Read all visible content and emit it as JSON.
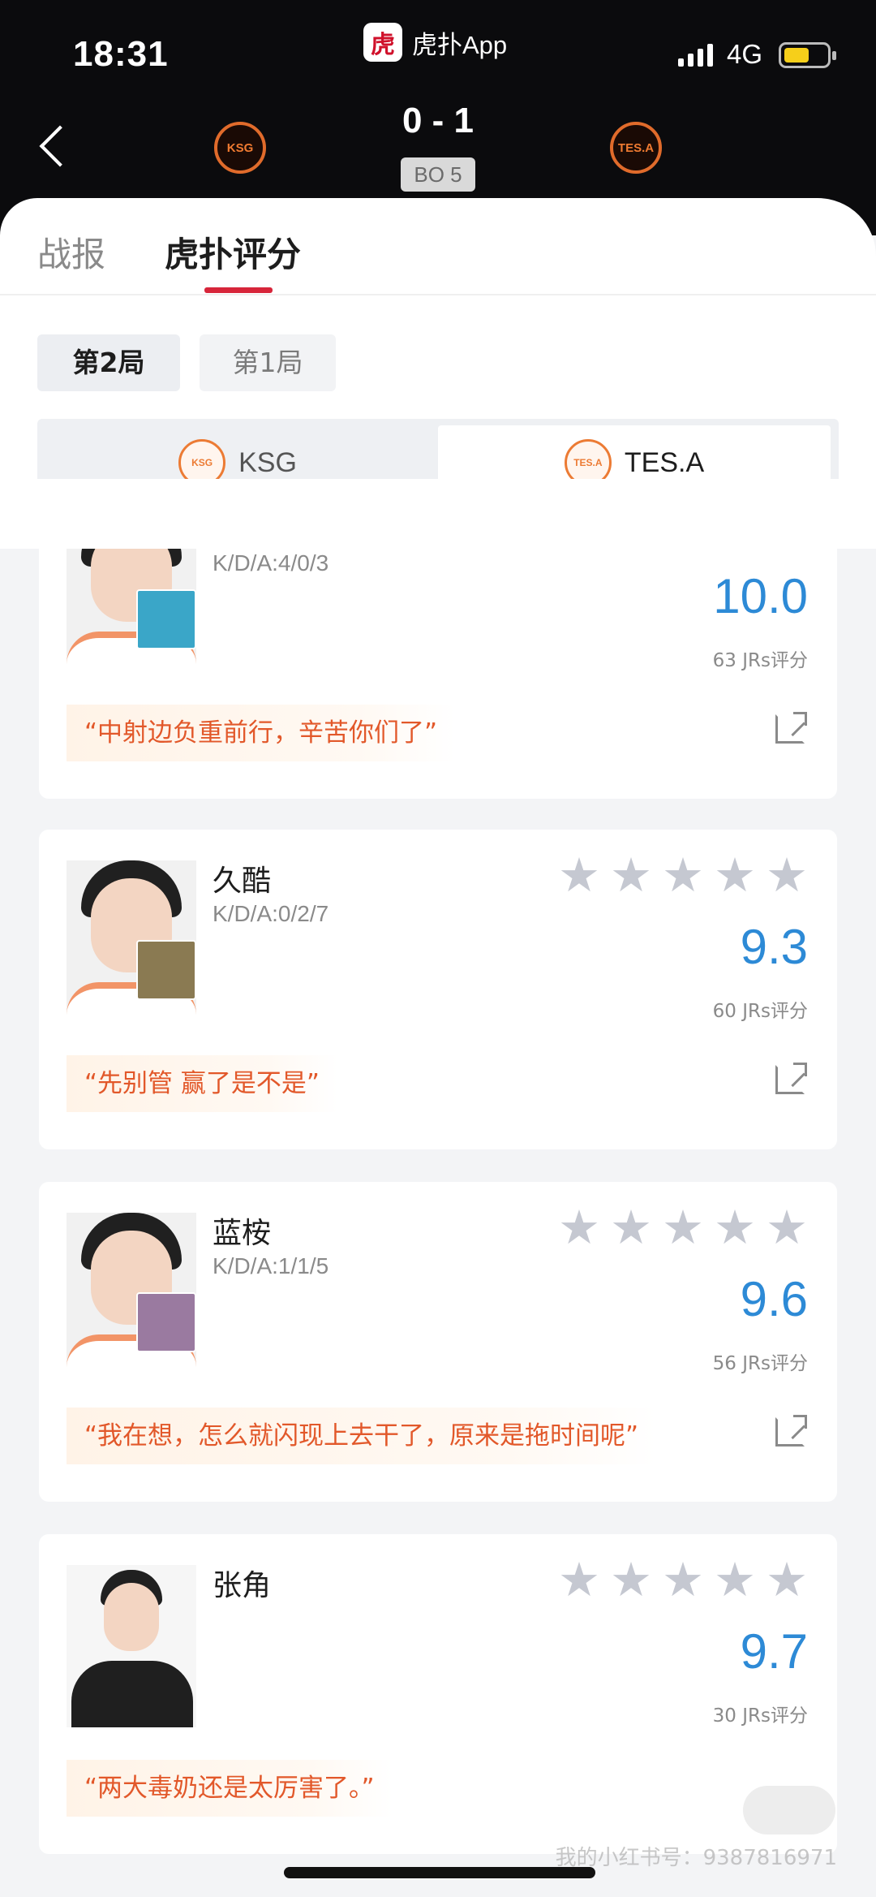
{
  "status_bar": {
    "time": "18:31",
    "app_name": "虎扑App",
    "network": "4G"
  },
  "match": {
    "score": "0 - 1",
    "format": "BO 5",
    "home_team_logo_text": "KSG",
    "away_team_logo_text": "TES.A"
  },
  "tabs": [
    {
      "label": "战报",
      "active": false
    },
    {
      "label": "虎扑评分",
      "active": true
    }
  ],
  "games": [
    {
      "label": "第2局",
      "active": true
    },
    {
      "label": "第1局",
      "active": false
    }
  ],
  "team_toggle": {
    "ksg": {
      "name": "KSG",
      "logo_text": "KSG"
    },
    "tes": {
      "name": "TES.A",
      "logo_text": "TES.A",
      "active": true
    }
  },
  "players": [
    {
      "name": "",
      "kda": "K/D/A:4/0/3",
      "stars": 5,
      "rating": "10.0",
      "jrs": "63 JRs评分",
      "quote": "“中射边负重前行，辛苦你们了”",
      "hero_color": "#3aa6c8"
    },
    {
      "name": "久酷",
      "kda": "K/D/A:0/2/7",
      "stars": 5,
      "rating": "9.3",
      "jrs": "60 JRs评分",
      "quote": "“先别管 赢了是不是”",
      "hero_color": "#8a7a52"
    },
    {
      "name": "蓝桉",
      "kda": "K/D/A:1/1/5",
      "stars": 5,
      "rating": "9.6",
      "jrs": "56 JRs评分",
      "quote": "“我在想，怎么就闪现上去干了，原来是拖时间呢”",
      "hero_color": "#9a7aa0"
    },
    {
      "name": "张角",
      "kda": "",
      "stars": 5,
      "rating": "9.7",
      "jrs": "30 JRs评分",
      "quote": "“两大毒奶还是太厉害了。”",
      "hero_color": ""
    }
  ],
  "watermark": "我的小红书号：9387816971",
  "colors": {
    "accent_red": "#d7253a",
    "rating_blue": "#2d8ad6",
    "quote_orange": "#e2582a",
    "star_gray": "#c5c8d1"
  }
}
